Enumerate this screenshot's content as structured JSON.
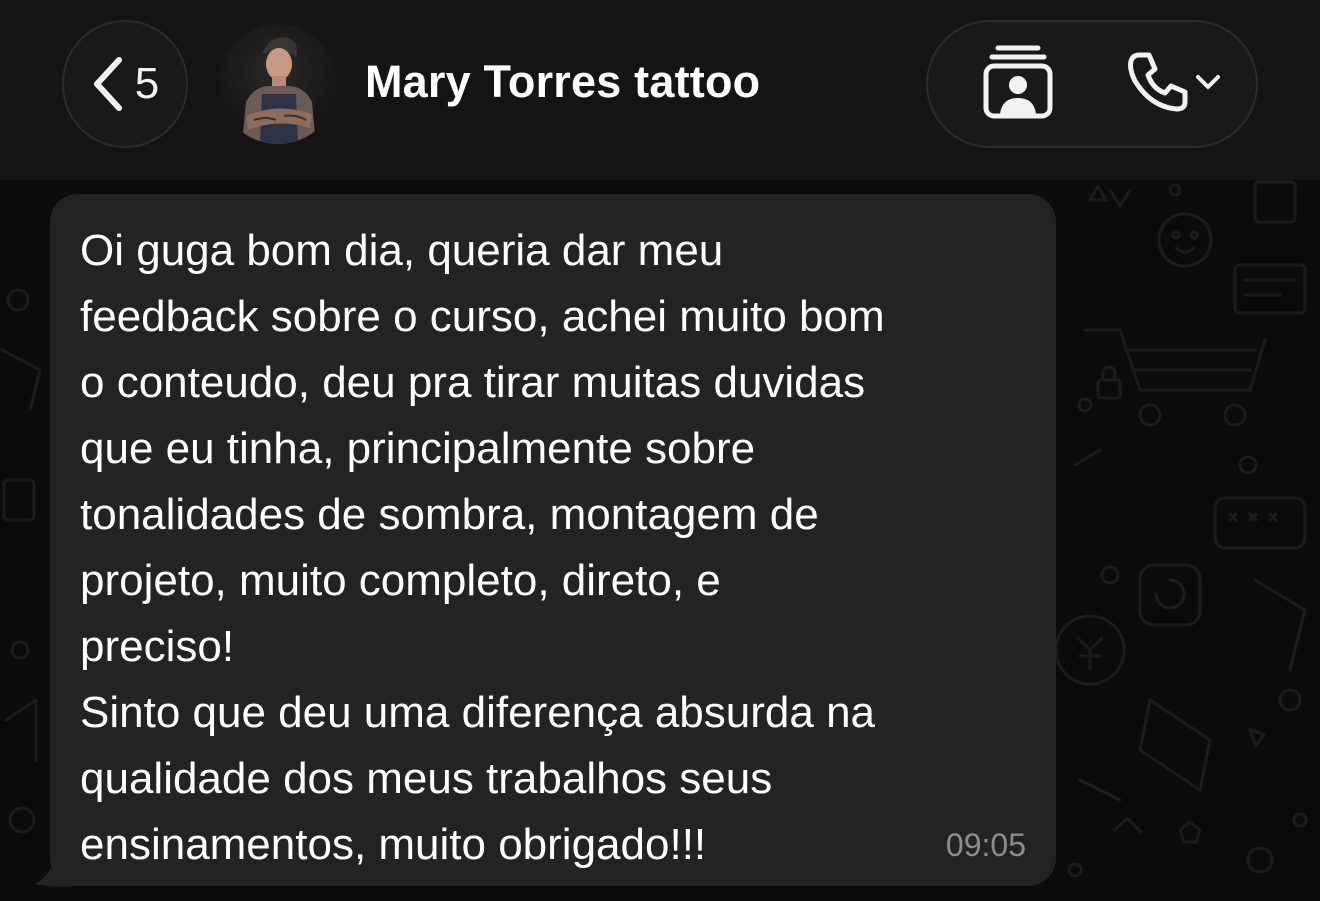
{
  "header": {
    "back_count": "5",
    "contact_name": "Mary Torres tattoo",
    "icons": {
      "back": "chevron-left-icon",
      "contact_card": "contact-card-icon",
      "call": "phone-icon",
      "call_menu": "chevron-down-icon"
    }
  },
  "message": {
    "text": "Oi guga bom dia, queria dar meu\nfeedback sobre o curso, achei muito bom\no conteudo, deu pra tirar muitas duvidas\nque eu tinha, principalmente sobre\ntonalidades de sombra, montagem de\nprojeto, muito completo, direto, e\npreciso!\nSinto que deu uma diferença absurda na\nqualidade dos meus trabalhos seus\nensinamentos, muito obrigado!!!",
    "time": "09:05"
  },
  "colors": {
    "background": "#0b0b0b",
    "header": "#141414",
    "bubble": "#232323",
    "text": "#ffffff",
    "timestamp": "#8d8d8d"
  }
}
